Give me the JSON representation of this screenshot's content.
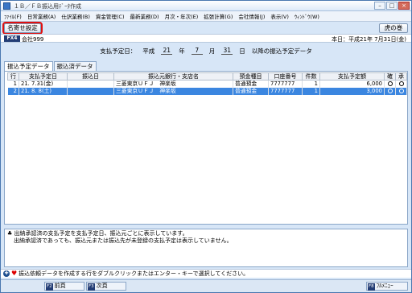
{
  "window": {
    "title": "１Ｂ／ＦＢ振込用ﾃﾞｰﾀ作成"
  },
  "menu": [
    "ﾌｧｲﾙ(F)",
    "日常業務(A)",
    "仕訳業務(B)",
    "資金管理(C)",
    "最新業務(D)",
    "月次・年次(E)",
    "拡張計算(G)",
    "会社情報(J)",
    "表示(V)",
    "ｳｨﾝﾄﾞｳ(W)"
  ],
  "toolbar": {
    "left_button": "名寄せ設定",
    "right_button": "虎の巻"
  },
  "company": {
    "badge": "FX4",
    "name": "会社999",
    "today": "本日：平成21年 7月31日(金)"
  },
  "header": {
    "label": "支払予定日：",
    "era": "平成",
    "year": "21",
    "year_unit": "年",
    "month": "7",
    "month_unit": "月",
    "day": "31",
    "day_unit": "日",
    "suffix": "以降の振込予定データ"
  },
  "tabs": [
    "振込予定データ",
    "振込済データ"
  ],
  "table": {
    "columns": [
      "行",
      "支払予定日",
      "振込日",
      "振込元銀行・支店名",
      "預金種目",
      "口座番号",
      "件数",
      "支払予定額",
      "確",
      "承"
    ],
    "rows": [
      {
        "row": "1",
        "date": "21. 7.31(金)",
        "transfer": "",
        "bank": "三菱東京ＵＦＪ　神楽坂",
        "type": "普通預金",
        "account": "7777777",
        "count": "1",
        "amount": "6,000"
      },
      {
        "row": "2",
        "date": "21. 8. 8(土)",
        "transfer": "",
        "bank": "三菱東京ＵＦＪ　神楽坂",
        "type": "普通預金",
        "account": "7777777",
        "count": "1",
        "amount": "3,000"
      }
    ]
  },
  "notes": {
    "line1": "♣ 出納承認済の支払予定を支払予定日、振込元ごとに表示しています。",
    "line2": "出納承認済であっても、振込元または振込先が未登録の支払予定は表示していません。"
  },
  "status": {
    "text": "振込依頼データを作成する行をダブルクリックまたはエンター・キーで選択してください。"
  },
  "fkeys": [
    {
      "key": "F2",
      "label": "前頁"
    },
    {
      "key": "F3",
      "label": "次頁"
    },
    {
      "key": "F8",
      "label": "ﾌﾙﾒﾆｭｰ"
    }
  ]
}
